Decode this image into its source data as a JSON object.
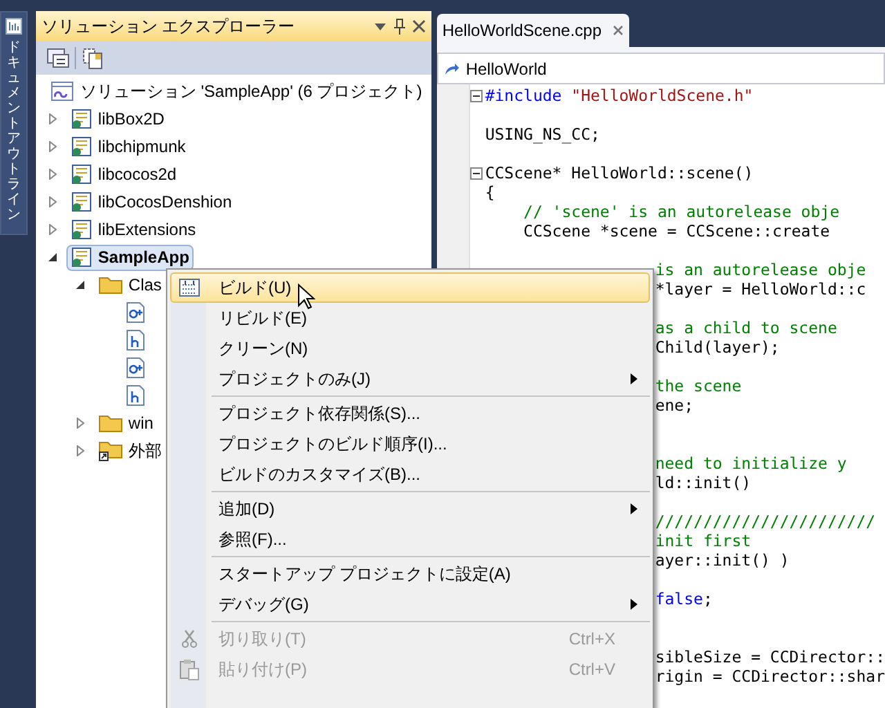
{
  "side_tab": {
    "label": "ドキュメントアウトライン"
  },
  "explorer": {
    "title": "ソリューション エクスプローラー",
    "solution": "ソリューション 'SampleApp' (6 プロジェクト)",
    "items": [
      {
        "label": "libBox2D",
        "kind": "project",
        "expanded": false,
        "selected": false
      },
      {
        "label": "libchipmunk",
        "kind": "project",
        "expanded": false,
        "selected": false
      },
      {
        "label": "libcocos2d",
        "kind": "project",
        "expanded": false,
        "selected": false
      },
      {
        "label": "libCocosDenshion",
        "kind": "project",
        "expanded": false,
        "selected": false
      },
      {
        "label": "libExtensions",
        "kind": "project",
        "expanded": false,
        "selected": false
      },
      {
        "label": "SampleApp",
        "kind": "project",
        "expanded": true,
        "selected": true,
        "children": [
          {
            "label": "Clas",
            "kind": "folder",
            "expanded": true,
            "selected": false,
            "children": [
              {
                "kind": "cpp",
                "selected": false
              },
              {
                "kind": "header",
                "selected": false
              },
              {
                "kind": "cpp",
                "selected": false
              },
              {
                "kind": "header",
                "selected": false
              }
            ]
          },
          {
            "label": "win",
            "kind": "folder",
            "expanded": false,
            "selected": false
          },
          {
            "label": "外部",
            "kind": "external",
            "expanded": false,
            "selected": false
          }
        ]
      }
    ]
  },
  "editor": {
    "tab": "HelloWorldScene.cpp",
    "nav": "HelloWorld",
    "lines": [
      {
        "kind": "fold",
        "tokens": [
          {
            "kind": "keyword",
            "text": "#include "
          },
          {
            "kind": "string",
            "text": "\"HelloWorldScene.h\""
          }
        ]
      },
      {
        "kind": "blank"
      },
      {
        "kind": "code",
        "tokens": [
          {
            "kind": "plain",
            "text": "USING_NS_CC;"
          }
        ]
      },
      {
        "kind": "blank"
      },
      {
        "kind": "fold",
        "tokens": [
          {
            "kind": "plain",
            "text": "CCScene* HelloWorld::scene()"
          }
        ]
      },
      {
        "kind": "code",
        "tokens": [
          {
            "kind": "plain",
            "text": "{"
          }
        ]
      },
      {
        "kind": "code",
        "tokens": [
          {
            "kind": "comment",
            "text": "    // 'scene' is an autorelease obje"
          }
        ]
      },
      {
        "kind": "code",
        "tokens": [
          {
            "kind": "plain",
            "text": "    CCScene *scene = CCScene::create"
          }
        ]
      },
      {
        "kind": "blank"
      }
    ],
    "partial_lines": [
      {
        "kind": "code",
        "tokens": [
          {
            "kind": "comment",
            "text": "is an autorelease obje"
          }
        ]
      },
      {
        "kind": "code",
        "tokens": [
          {
            "kind": "plain",
            "text": "*layer = HelloWorld::c"
          }
        ]
      },
      {
        "kind": "blank"
      },
      {
        "kind": "code",
        "tokens": [
          {
            "kind": "comment",
            "text": "as a child to scene"
          }
        ]
      },
      {
        "kind": "code",
        "tokens": [
          {
            "kind": "plain",
            "text": "Child(layer);"
          }
        ]
      },
      {
        "kind": "blank"
      },
      {
        "kind": "code",
        "tokens": [
          {
            "kind": "comment",
            "text": "the scene"
          }
        ]
      },
      {
        "kind": "code",
        "tokens": [
          {
            "kind": "plain",
            "text": "ene;"
          }
        ]
      },
      {
        "kind": "blank"
      },
      {
        "kind": "blank"
      },
      {
        "kind": "code",
        "tokens": [
          {
            "kind": "comment",
            "text": "need to initialize y"
          }
        ]
      },
      {
        "kind": "code",
        "tokens": [
          {
            "kind": "plain",
            "text": "ld::init()"
          }
        ]
      },
      {
        "kind": "blank"
      },
      {
        "kind": "code",
        "tokens": [
          {
            "kind": "comment",
            "text": "///////////////////////"
          }
        ]
      },
      {
        "kind": "code",
        "tokens": [
          {
            "kind": "comment",
            "text": "init first"
          }
        ]
      },
      {
        "kind": "code",
        "tokens": [
          {
            "kind": "plain",
            "text": "ayer::init() )"
          }
        ]
      },
      {
        "kind": "blank"
      },
      {
        "kind": "code",
        "tokens": [
          {
            "kind": "keyword",
            "text": "false"
          },
          {
            "kind": "plain",
            "text": ";"
          }
        ]
      },
      {
        "kind": "blank"
      },
      {
        "kind": "blank"
      },
      {
        "kind": "code",
        "tokens": [
          {
            "kind": "plain",
            "text": "sibleSize = CCDirector::"
          }
        ]
      },
      {
        "kind": "code",
        "tokens": [
          {
            "kind": "plain",
            "text": "rigin = CCDirector::shar"
          }
        ]
      }
    ]
  },
  "context_menu": [
    {
      "kind": "item",
      "label": "ビルド(U)",
      "submenu": false,
      "selected": true,
      "disabled": false
    },
    {
      "kind": "item",
      "label": "リビルド(E)",
      "submenu": false,
      "selected": false,
      "disabled": false
    },
    {
      "kind": "item",
      "label": "クリーン(N)",
      "submenu": false,
      "selected": false,
      "disabled": false
    },
    {
      "kind": "item",
      "label": "プロジェクトのみ(J)",
      "submenu": true,
      "selected": false,
      "disabled": false
    },
    {
      "kind": "separator"
    },
    {
      "kind": "item",
      "label": "プロジェクト依存関係(S)...",
      "submenu": false,
      "selected": false,
      "disabled": false
    },
    {
      "kind": "item",
      "label": "プロジェクトのビルド順序(I)...",
      "submenu": false,
      "selected": false,
      "disabled": false
    },
    {
      "kind": "item",
      "label": "ビルドのカスタマイズ(B)...",
      "submenu": false,
      "selected": false,
      "disabled": false
    },
    {
      "kind": "separator"
    },
    {
      "kind": "item",
      "label": "追加(D)",
      "submenu": true,
      "selected": false,
      "disabled": false
    },
    {
      "kind": "item",
      "label": "参照(F)...",
      "submenu": false,
      "selected": false,
      "disabled": false
    },
    {
      "kind": "separator"
    },
    {
      "kind": "item",
      "label": "スタートアップ プロジェクトに設定(A)",
      "submenu": false,
      "selected": false,
      "disabled": false
    },
    {
      "kind": "item",
      "label": "デバッグ(G)",
      "submenu": true,
      "selected": false,
      "disabled": false
    },
    {
      "kind": "separator"
    },
    {
      "kind": "item",
      "label": "切り取り(T)",
      "shortcut": "Ctrl+X",
      "submenu": false,
      "selected": false,
      "disabled": true
    },
    {
      "kind": "item",
      "label": "貼り付け(P)",
      "shortcut": "Ctrl+V",
      "submenu": false,
      "selected": false,
      "disabled": true
    }
  ]
}
